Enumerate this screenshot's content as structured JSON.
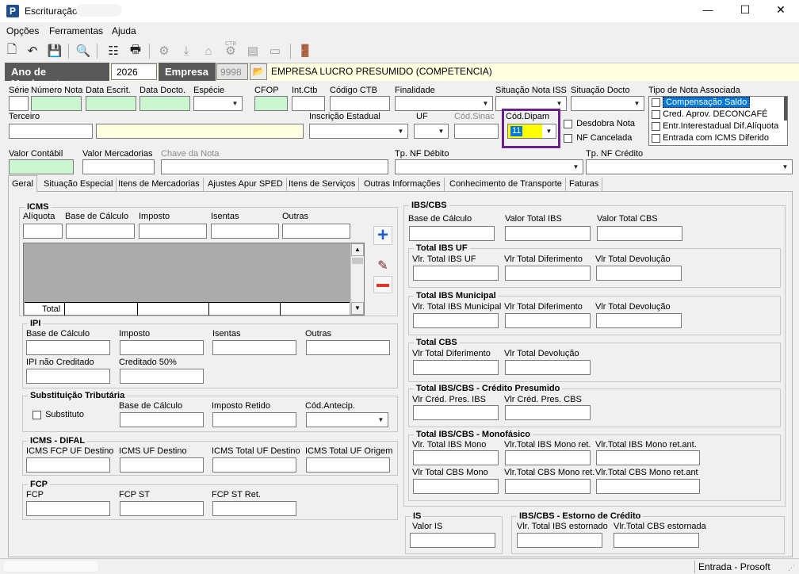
{
  "window": {
    "title": "Escrituração",
    "min": "—",
    "max": "☐",
    "close": "✕"
  },
  "menu": [
    "Opções",
    "Ferramentas",
    "Ajuda"
  ],
  "toolbar": {
    "icons": [
      "new-doc-icon",
      "undo-icon",
      "save-icon",
      "preview-icon",
      "tree-icon",
      "print-icon",
      "gear-icon",
      "download-icon",
      "home-icon",
      "ctb-icon",
      "book-icon",
      "exit-icon"
    ],
    "ctb": "CTB"
  },
  "header": {
    "ano_label": "Ano de Movimento",
    "ano_value": "2026",
    "empresa_label": "Empresa",
    "empresa_code": "9998",
    "empresa_name": "EMPRESA LUCRO PRESUMIDO (COMPETENCIA)"
  },
  "row1": {
    "serie": "Série",
    "numero": "Número Nota",
    "data_escrit": "Data Escrit.",
    "data_docto": "Data Docto.",
    "especie": "Espécie",
    "cfop": "CFOP",
    "int_ctb": "Int.Ctb",
    "codigo_ctb": "Código CTB",
    "finalidade": "Finalidade",
    "sit_iss": "Situação Nota ISS",
    "sit_docto": "Situação Docto",
    "tipo_nota": "Tipo de Nota Associada"
  },
  "tipo_nota_items": [
    "Compensação Saldo",
    "Cred. Aprov. DECONCAFÉ",
    "Entr.Interestadual Dif.Alíquota",
    "Entrada com ICMS Diferido"
  ],
  "row2": {
    "terceiro": "Terceiro",
    "insc_est": "Inscrição Estadual",
    "uf": "UF",
    "cod_sinac": "Cód.Sinac",
    "cod_dipam": "Cód.Dipam",
    "cod_dipam_value": "11",
    "desdobra": "Desdobra Nota",
    "nf_cancelada": "NF Cancelada"
  },
  "row3": {
    "valor_contabil": "Valor Contábil",
    "valor_merc": "Valor Mercadorias",
    "chave": "Chave da Nota",
    "tp_debito": "Tp. NF Débito",
    "tp_credito": "Tp. NF Crédito"
  },
  "tabs": [
    "Geral",
    "Situação Especial",
    "Itens de Mercadorias",
    "Ajustes Apur SPED",
    "Itens de Serviços",
    "Outras Informações",
    "Conhecimento de Transporte",
    "Faturas"
  ],
  "icms": {
    "title": "ICMS",
    "aliquota": "Alíquota",
    "base": "Base de Cálculo",
    "imposto": "Imposto",
    "isentas": "Isentas",
    "outras": "Outras",
    "total": "Total"
  },
  "ipi": {
    "title": "IPI",
    "base": "Base de Cálculo",
    "imposto": "Imposto",
    "isentas": "Isentas",
    "outras": "Outras",
    "nao_cred": "IPI não Creditado",
    "cred50": "Creditado 50%"
  },
  "st": {
    "title": "Substituição Tributária",
    "substituto": "Substituto",
    "base": "Base de Cálculo",
    "retido": "Imposto Retido",
    "antecip": "Cód.Antecip."
  },
  "difal": {
    "title": "ICMS - DIFAL",
    "fcp_dest": "ICMS FCP UF Destino",
    "uf_dest": "ICMS UF Destino",
    "total_dest": "ICMS Total UF Destino",
    "total_orig": "ICMS Total UF Origem"
  },
  "fcp": {
    "title": "FCP",
    "fcp": "FCP",
    "fcp_st": "FCP ST",
    "fcp_st_ret": "FCP ST Ret."
  },
  "ibscbs": {
    "title": "IBS/CBS",
    "base": "Base de Cálculo",
    "vt_ibs": "Valor Total IBS",
    "vt_cbs": "Valor Total CBS"
  },
  "ibs_uf": {
    "title": "Total IBS UF",
    "vlr": "Vlr. Total IBS UF",
    "dif": "Vlr Total Diferimento",
    "dev": "Vlr Total Devolução"
  },
  "ibs_mun": {
    "title": "Total IBS Municipal",
    "vlr": "Vlr. Total IBS Municipal",
    "dif": "Vlr Total Diferimento",
    "dev": "Vlr Total Devolução"
  },
  "cbs": {
    "title": "Total CBS",
    "dif": "Vlr Total Diferimento",
    "dev": "Vlr Total Devolução"
  },
  "presumido": {
    "title": "Total IBS/CBS - Crédito Presumido",
    "ibs": "Vlr Créd. Pres. IBS",
    "cbs": "Vlr Créd. Pres. CBS"
  },
  "mono": {
    "title": "Total IBS/CBS - Monofásico",
    "a": "Vlr. Total IBS Mono",
    "b": "Vlr.Total IBS Mono ret.",
    "c": "Vlr.Total IBS Mono ret.ant.",
    "d": "Vlr Total CBS Mono",
    "e": "Vlr.Total CBS Mono ret.",
    "f": "Vlr.Total CBS Mono ret.ant"
  },
  "is": {
    "title": "IS",
    "valor": "Valor IS"
  },
  "estorno": {
    "title": "IBS/CBS - Estorno de Crédito",
    "ibs": "Vlr. Total IBS estornado",
    "cbs": "Vlr.Total CBS estornada"
  },
  "status": {
    "text": "Entrada - Prosoft"
  },
  "colors": {
    "green_field": "#ccf5d2",
    "yellow_field": "#ffffe1",
    "header_bar": "#595959",
    "dipam_border": "#6b1f8c",
    "selection": "#0078d7",
    "add_blue": "#1a5fc8",
    "remove_red": "#e0342a"
  }
}
